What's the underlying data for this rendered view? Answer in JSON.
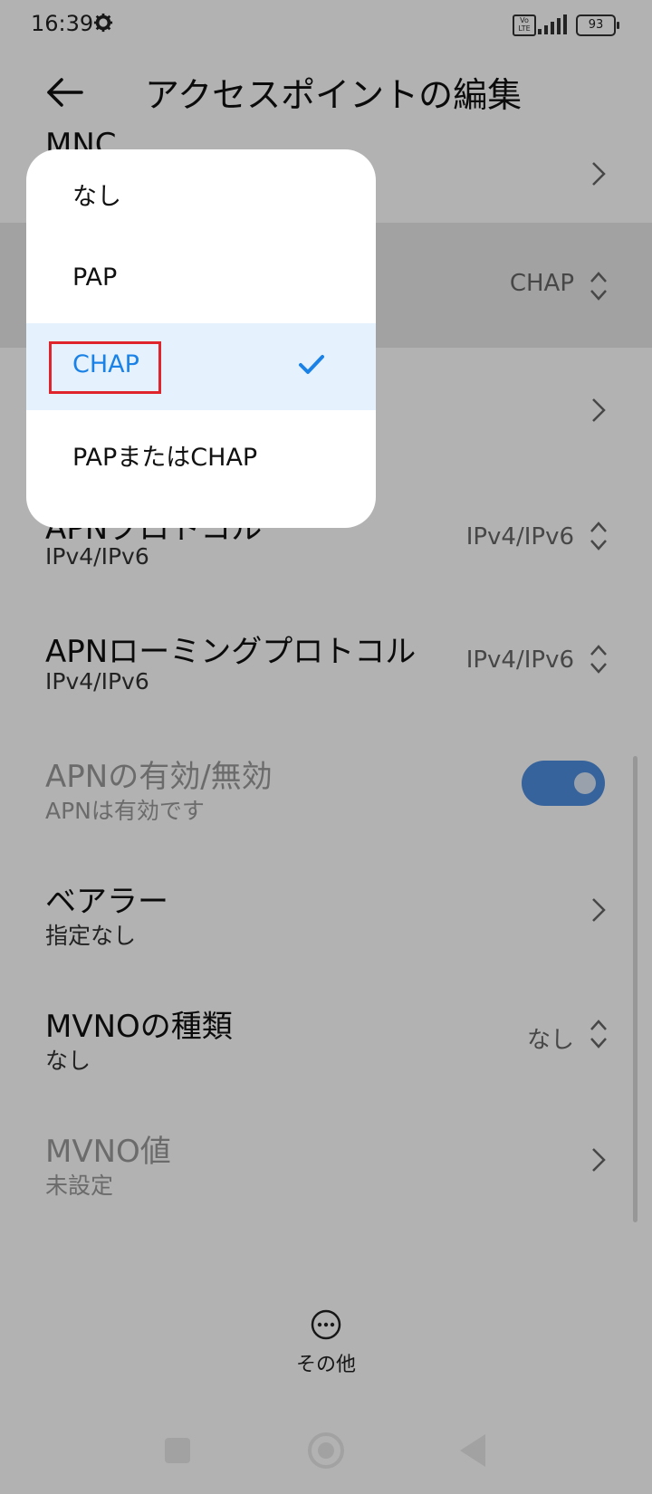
{
  "status_bar": {
    "time": "16:39",
    "volte": "Vo LTE",
    "battery": "93"
  },
  "header": {
    "title": "アクセスポイントの編集"
  },
  "rows": [
    {
      "title": "MNC"
    },
    {
      "value": "CHAP"
    },
    {},
    {
      "title": "APNプロトコル",
      "subtitle": "IPv4/IPv6",
      "value": "IPv4/IPv6"
    },
    {
      "title": "APNローミングプロトコル",
      "subtitle": "IPv4/IPv6",
      "value": "IPv4/IPv6"
    },
    {
      "title": "APNの有効/無効",
      "subtitle": "APNは有効です",
      "enabled": true
    },
    {
      "title": "ベアラー",
      "subtitle": "指定なし"
    },
    {
      "title": "MVNOの種類",
      "subtitle": "なし",
      "value": "なし"
    },
    {
      "title": "MVNO値",
      "subtitle": "未設定"
    }
  ],
  "more": {
    "label": "その他"
  },
  "dialog": {
    "options": [
      {
        "label": "なし"
      },
      {
        "label": "PAP"
      },
      {
        "label": "CHAP",
        "selected": true
      },
      {
        "label": "PAPまたはCHAP"
      }
    ]
  },
  "colors": {
    "accent": "#1a82e6",
    "highlight_box": "#e0242b",
    "toggle": "#4f8fe0"
  }
}
